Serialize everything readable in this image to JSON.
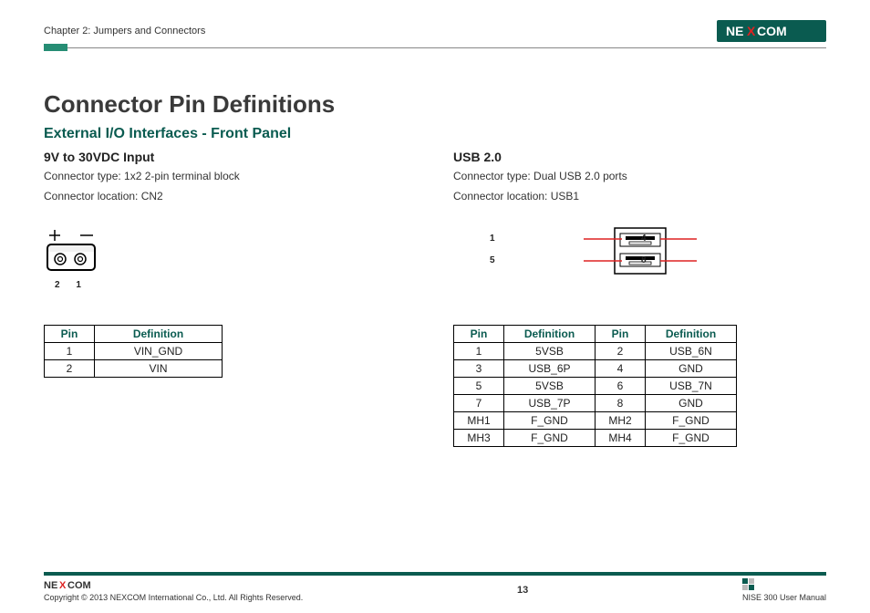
{
  "header": {
    "chapter": "Chapter 2: Jumpers and Connectors",
    "logo_text": "NEXCOM"
  },
  "titles": {
    "main": "Connector Pin Definitions",
    "sub": "External I/O Interfaces - Front Panel"
  },
  "left": {
    "heading": "9V to 30VDC Input",
    "conn_type": "Connector type: 1x2 2-pin terminal block",
    "conn_loc": "Connector location: CN2",
    "diagram": {
      "pin1_label": "1",
      "pin2_label": "2"
    },
    "table": {
      "headers": {
        "pin": "Pin",
        "def": "Definition"
      },
      "rows": [
        {
          "pin": "1",
          "def": "VIN_GND"
        },
        {
          "pin": "2",
          "def": "VIN"
        }
      ]
    }
  },
  "right": {
    "heading": "USB 2.0",
    "conn_type": "Connector type: Dual USB 2.0 ports",
    "conn_loc": "Connector location: USB1",
    "diagram": {
      "p1": "1",
      "p4": "4",
      "p5": "5",
      "p8": "8"
    },
    "table": {
      "headers": {
        "pin": "Pin",
        "def": "Definition"
      },
      "rows": [
        {
          "p1": "1",
          "d1": "5VSB",
          "p2": "2",
          "d2": "USB_6N"
        },
        {
          "p1": "3",
          "d1": "USB_6P",
          "p2": "4",
          "d2": "GND"
        },
        {
          "p1": "5",
          "d1": "5VSB",
          "p2": "6",
          "d2": "USB_7N"
        },
        {
          "p1": "7",
          "d1": "USB_7P",
          "p2": "8",
          "d2": "GND"
        },
        {
          "p1": "MH1",
          "d1": "F_GND",
          "p2": "MH2",
          "d2": "F_GND"
        },
        {
          "p1": "MH3",
          "d1": "F_GND",
          "p2": "MH4",
          "d2": "F_GND"
        }
      ]
    }
  },
  "footer": {
    "copyright": "Copyright © 2013 NEXCOM International Co., Ltd. All Rights Reserved.",
    "page": "13",
    "manual": "NISE 300 User Manual"
  }
}
